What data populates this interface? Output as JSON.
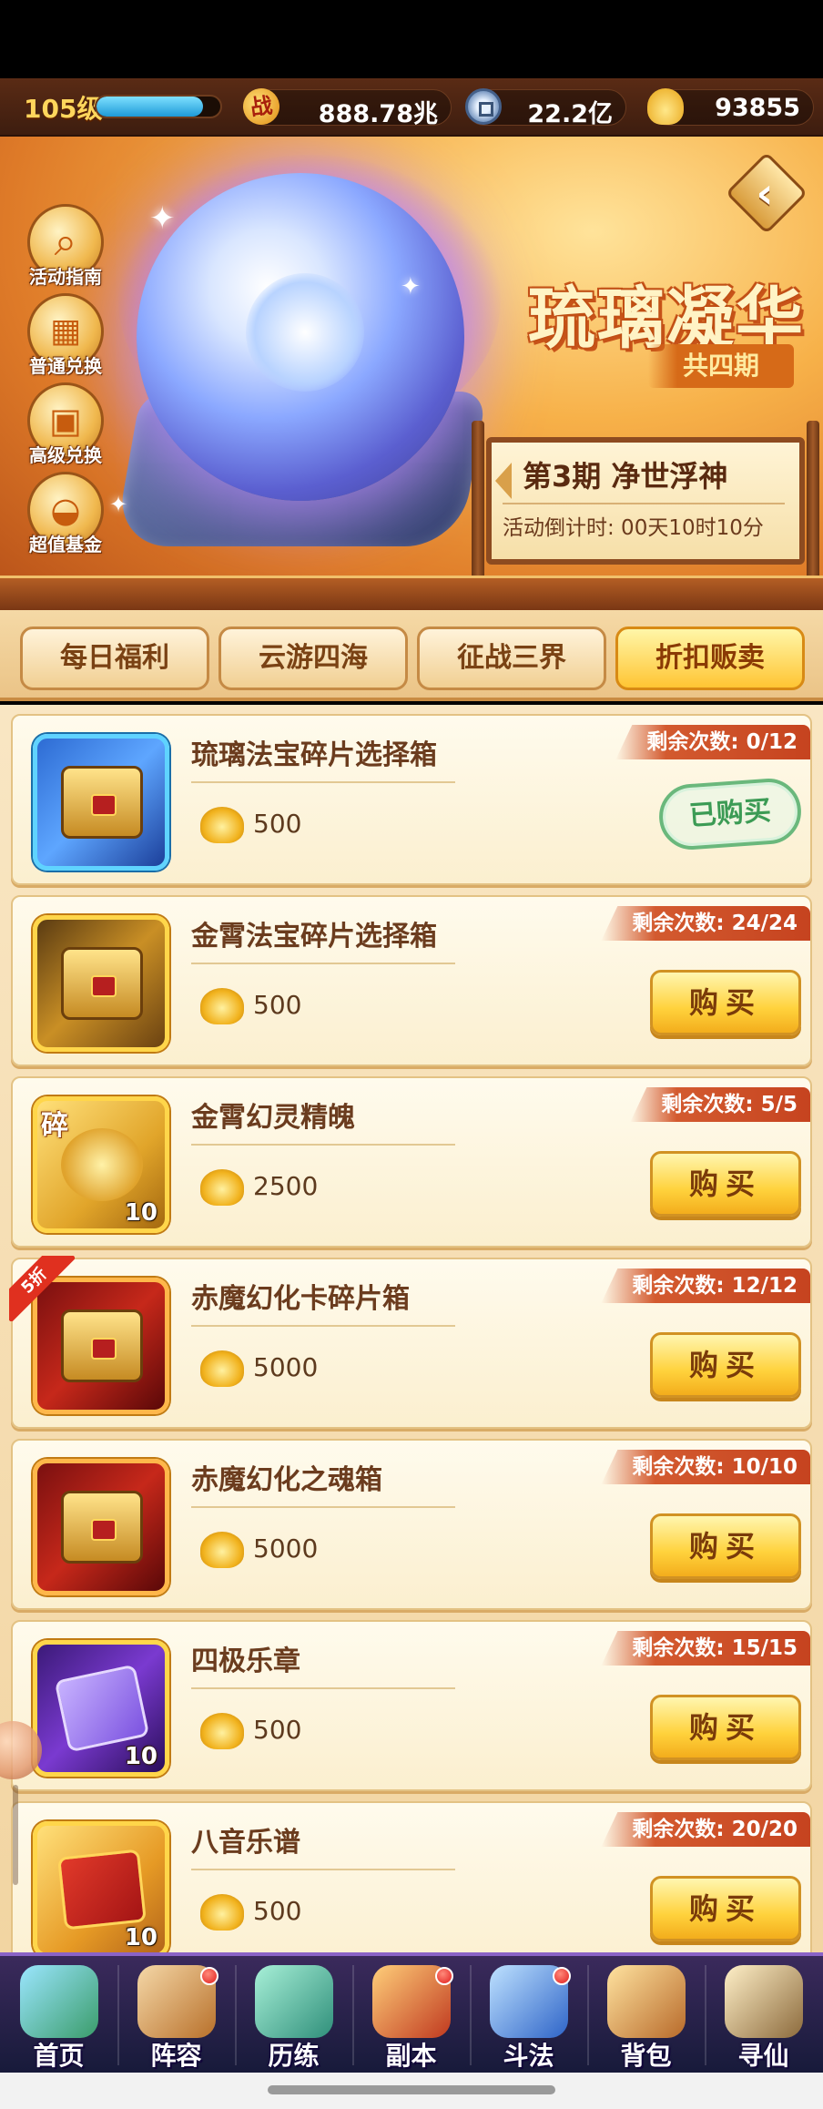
{
  "resources": {
    "level": "105级",
    "exp_fraction": 0.86,
    "power_icon_glyph": "战",
    "power": "888.78兆",
    "silver": "22.2亿",
    "gold": "93855"
  },
  "banner": {
    "title": "琉璃凝华",
    "subtitle": "共四期",
    "period_name": "第3期  净世浮神",
    "countdown": "活动倒计时: 00天10时10分",
    "side_buttons": [
      {
        "label": "活动指南",
        "icon": "search-icon"
      },
      {
        "label": "普通兑换",
        "icon": "scroll-icon"
      },
      {
        "label": "高级兑换",
        "icon": "gift-icon"
      },
      {
        "label": "超值基金",
        "icon": "treasure-pot-icon"
      }
    ]
  },
  "tabs": [
    {
      "label": "每日福利",
      "active": false
    },
    {
      "label": "云游四海",
      "active": false
    },
    {
      "label": "征战三界",
      "active": false
    },
    {
      "label": "折扣贩卖",
      "active": true
    }
  ],
  "shop": {
    "buy_label": "购买",
    "bought_label": "已购买",
    "items": [
      {
        "name": "琉璃法宝碎片选择箱",
        "price": "500",
        "remain": "剩余次数: 0/12",
        "bought": true,
        "icon": "glass-treasure-chest-icon"
      },
      {
        "name": "金霄法宝碎片选择箱",
        "price": "500",
        "remain": "剩余次数: 24/24",
        "bought": false,
        "icon": "gold-treasure-chest-icon"
      },
      {
        "name": "金霄幻灵精魄",
        "price": "2500",
        "remain": "剩余次数: 5/5",
        "bought": false,
        "icon": "golden-dragon-icon",
        "badge": "碎",
        "count": "10"
      },
      {
        "name": "赤魔幻化卡碎片箱",
        "price": "5000",
        "remain": "剩余次数: 12/12",
        "bought": false,
        "icon": "red-demon-chest-icon",
        "discount": "5折"
      },
      {
        "name": "赤魔幻化之魂箱",
        "price": "5000",
        "remain": "剩余次数: 10/10",
        "bought": false,
        "icon": "red-soul-chest-icon"
      },
      {
        "name": "四极乐章",
        "price": "500",
        "remain": "剩余次数: 15/15",
        "bought": false,
        "icon": "purple-music-book-icon",
        "count": "10"
      },
      {
        "name": "八音乐谱",
        "price": "500",
        "remain": "剩余次数: 20/20",
        "bought": false,
        "icon": "red-music-book-icon",
        "count": "10"
      }
    ]
  },
  "bottom_nav": [
    {
      "label": "首页",
      "icon": "home-icon",
      "dot": false
    },
    {
      "label": "阵容",
      "icon": "lineup-icon",
      "dot": true
    },
    {
      "label": "历练",
      "icon": "training-icon",
      "dot": false
    },
    {
      "label": "副本",
      "icon": "dungeon-icon",
      "dot": true
    },
    {
      "label": "斗法",
      "icon": "battle-icon",
      "dot": true
    },
    {
      "label": "背包",
      "icon": "backpack-icon",
      "dot": false
    },
    {
      "label": "寻仙",
      "icon": "seek-immortal-icon",
      "dot": false
    }
  ]
}
